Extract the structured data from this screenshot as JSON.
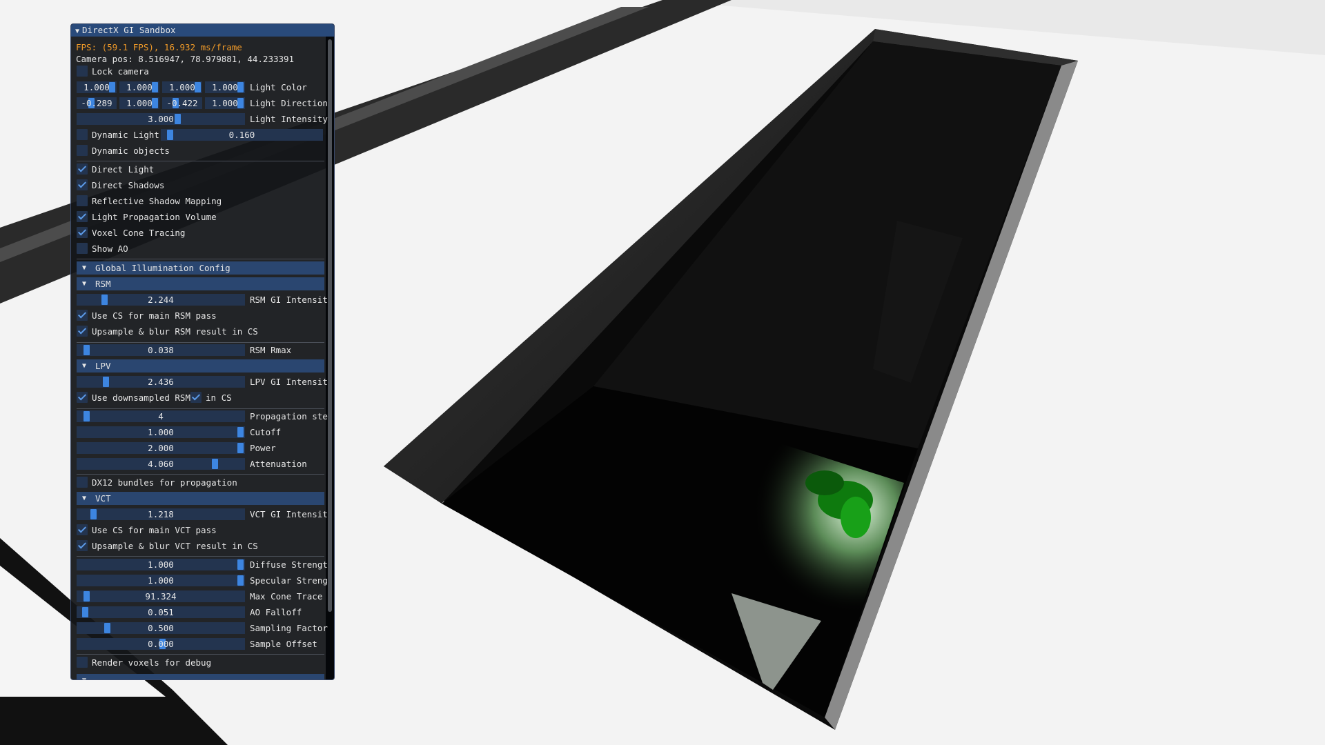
{
  "window": {
    "title": "DirectX GI Sandbox",
    "collapse_icon": "triangle-down"
  },
  "stats": {
    "fps": "FPS: (59.1 FPS), 16.932 ms/frame",
    "camera": "Camera pos: 8.516947, 78.979881, 44.233391"
  },
  "controls": {
    "lock_camera": {
      "label": "Lock camera",
      "checked": false
    },
    "light_color": {
      "values": [
        "1.000",
        "1.000",
        "1.000",
        "1.000"
      ],
      "label": "Light Color"
    },
    "light_direction": {
      "values": [
        "-0.289",
        "1.000",
        "-0.422",
        "1.000"
      ],
      "label": "Light Direction"
    },
    "light_intensity": {
      "value": "3.000",
      "label": "Light Intensity"
    },
    "dynamic_light": {
      "label": "Dynamic Light",
      "checked": false,
      "value": "0.160"
    },
    "dynamic_objects": {
      "label": "Dynamic objects",
      "checked": false
    }
  },
  "toggles": [
    {
      "label": "Direct Light",
      "checked": true
    },
    {
      "label": "Direct Shadows",
      "checked": true
    },
    {
      "label": "Reflective Shadow Mapping",
      "checked": false
    },
    {
      "label": "Light Propagation Volume",
      "checked": true
    },
    {
      "label": "Voxel Cone Tracing",
      "checked": true
    },
    {
      "label": "Show AO",
      "checked": false
    }
  ],
  "gi_config": {
    "header": "Global Illumination Config",
    "rsm": {
      "header": "RSM",
      "intensity": {
        "value": "2.244",
        "label": "RSM GI Intensit"
      },
      "use_cs": {
        "label": "Use CS for main RSM pass",
        "checked": true
      },
      "upsample": {
        "label": "Upsample & blur RSM result in CS",
        "checked": true
      },
      "rmax": {
        "value": "0.038",
        "label": "RSM Rmax"
      }
    },
    "lpv": {
      "header": "LPV",
      "intensity": {
        "value": "2.436",
        "label": "LPV GI Intensit"
      },
      "use_downsampled": {
        "label": "Use downsampled RSM",
        "checked": true
      },
      "in_cs": {
        "label": "in CS",
        "checked": true
      },
      "propagation": {
        "value": "4",
        "label": "Propagation ste"
      },
      "cutoff": {
        "value": "1.000",
        "label": "Cutoff"
      },
      "power": {
        "value": "2.000",
        "label": "Power"
      },
      "attenuation": {
        "value": "4.060",
        "label": "Attenuation"
      },
      "dx12_bundles": {
        "label": "DX12 bundles for propagation",
        "checked": false
      }
    },
    "vct": {
      "header": "VCT",
      "intensity": {
        "value": "1.218",
        "label": "VCT GI Intensit"
      },
      "use_cs": {
        "label": "Use CS for main VCT pass",
        "checked": true
      },
      "upsample": {
        "label": "Upsample & blur VCT result in CS",
        "checked": true
      },
      "diffuse": {
        "value": "1.000",
        "label": "Diffuse Strengt"
      },
      "specular": {
        "value": "1.000",
        "label": "Specular Streng"
      },
      "max_cone": {
        "value": "91.324",
        "label": "Max Cone Trace"
      },
      "ao_falloff": {
        "value": "0.051",
        "label": "AO Falloff"
      },
      "sampling": {
        "value": "0.500",
        "label": "Sampling Factor"
      },
      "sample_offset": {
        "value": "0.000",
        "label": "Sample Offset"
      },
      "render_voxels": {
        "label": "Render voxels for debug",
        "checked": false
      }
    }
  },
  "colors": {
    "panel_bg": "#14161a",
    "title_bg": "#294a7a",
    "frame_bg": "#23344f",
    "grab": "#3d85e0",
    "check": "#5d9be8",
    "fps_text": "#f09a28"
  }
}
